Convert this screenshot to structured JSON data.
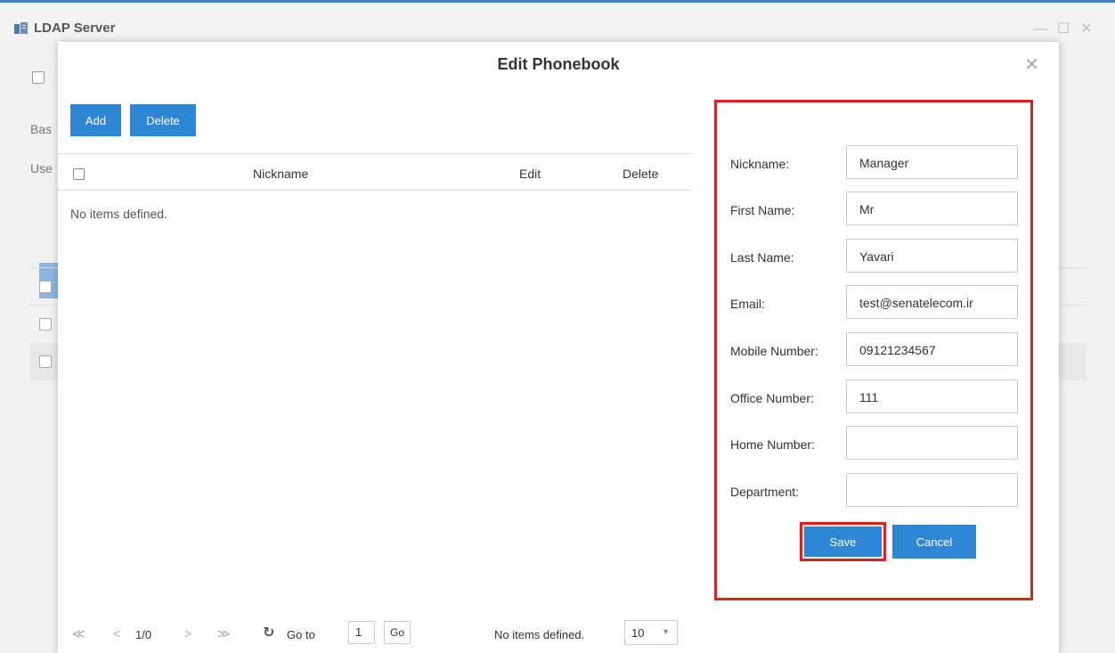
{
  "window": {
    "title": "LDAP Server",
    "minimize_glyph": "—",
    "maximize_glyph": "☐",
    "close_glyph": "✕"
  },
  "background": {
    "label_bas": "Bas",
    "label_use": "Use"
  },
  "modal": {
    "title": "Edit Phonebook",
    "close_glyph": "✕"
  },
  "toolbar": {
    "add_label": "Add",
    "delete_label": "Delete"
  },
  "table": {
    "columns": [
      "Nickname",
      "Edit",
      "Delete"
    ],
    "empty_message": "No items defined."
  },
  "pagination": {
    "first_glyph": "≪",
    "prev_glyph": "<",
    "page_info": "1/0",
    "next_glyph": ">",
    "last_glyph": "≫",
    "refresh_glyph": "↻",
    "goto_label": "Go to",
    "goto_value": "1",
    "go_label": "Go",
    "status": "No items defined.",
    "page_size": "10",
    "dropdown_glyph": "▼"
  },
  "form": {
    "fields": [
      {
        "label": "Nickname:",
        "value": "Manager"
      },
      {
        "label": "First Name:",
        "value": "Mr"
      },
      {
        "label": "Last Name:",
        "value": "Yavari"
      },
      {
        "label": "Email:",
        "value": "test@senatelecom.ir"
      },
      {
        "label": "Mobile Number:",
        "value": "09121234567"
      },
      {
        "label": "Office Number:",
        "value": "111"
      },
      {
        "label": "Home Number:",
        "value": ""
      },
      {
        "label": "Department:",
        "value": ""
      }
    ],
    "save_label": "Save",
    "cancel_label": "Cancel"
  },
  "colors": {
    "primary": "#2f86d6",
    "highlight": "#e0201e",
    "topline": "#3a82cc"
  }
}
